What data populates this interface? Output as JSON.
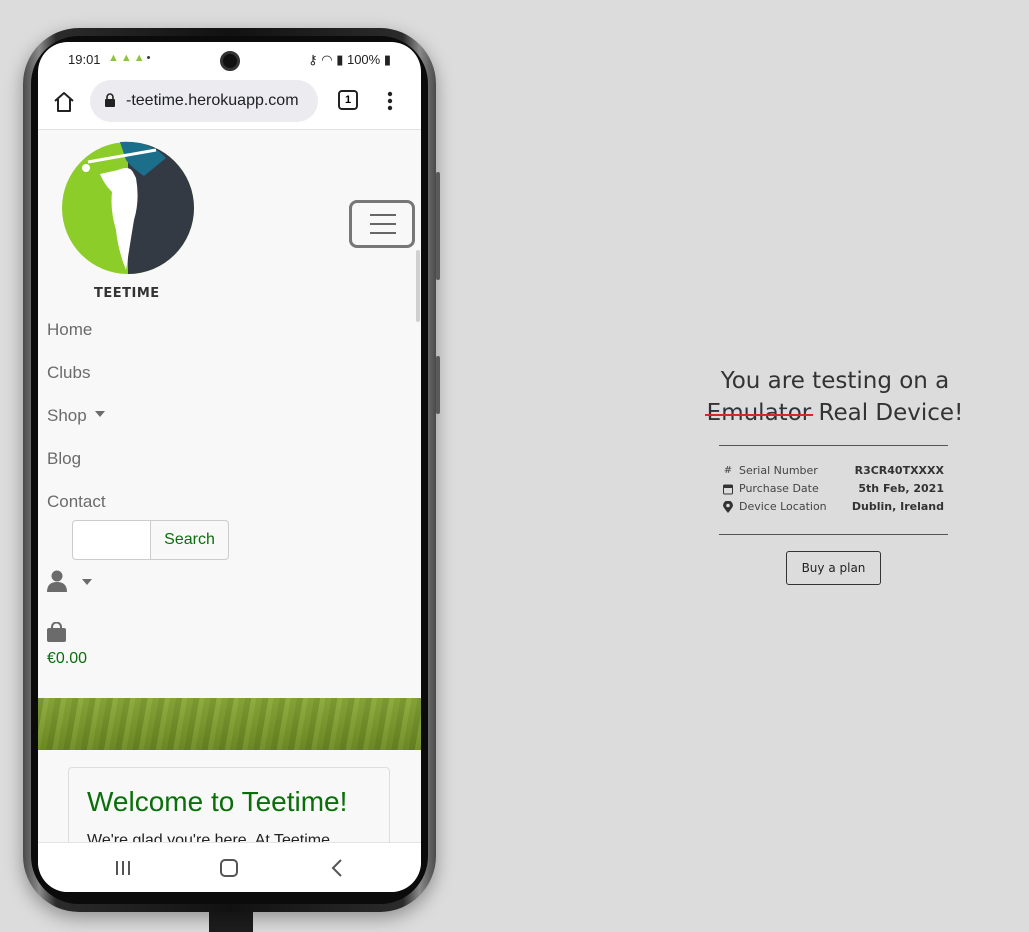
{
  "phone": {
    "status_bar": {
      "time": "19:01",
      "left_icons": [
        "android-icon",
        "android-icon",
        "android-icon",
        "dot-icon"
      ],
      "right_icons": [
        "key-icon",
        "wifi-icon",
        "signal-icon"
      ],
      "battery": "100%"
    },
    "browser": {
      "url": "-teetime.herokuapp.com",
      "tab_count": "1"
    },
    "site": {
      "logo_text": "TEETIME",
      "nav": [
        {
          "label": "Home"
        },
        {
          "label": "Clubs"
        },
        {
          "label": "Shop"
        },
        {
          "label": "Blog"
        },
        {
          "label": "Contact"
        }
      ],
      "search": {
        "placeholder": "",
        "button": "Search"
      },
      "cart_total": "€0.00",
      "welcome": {
        "title": "Welcome to Teetime!",
        "body": "We're glad you're here. At Teetime"
      }
    },
    "colors": {
      "accent": "#0b6e0b",
      "logo_green": "#8ccd2a",
      "logo_dark": "#333a44",
      "logo_teal": "#1b6f8a"
    }
  },
  "panel": {
    "heading_prefix": "You are testing on a",
    "struck_word": "Emulator",
    "heading_suffix": "Real Device!",
    "rows": [
      {
        "icon": "hash-icon",
        "label": "Serial Number",
        "value": "R3CR40TXXXX"
      },
      {
        "icon": "calendar-icon",
        "label": "Purchase Date",
        "value": "5th Feb, 2021"
      },
      {
        "icon": "location-pin-icon",
        "label": "Device Location",
        "value": "Dublin, Ireland"
      }
    ],
    "button": "Buy a plan",
    "strike_color": "#d9262b"
  }
}
